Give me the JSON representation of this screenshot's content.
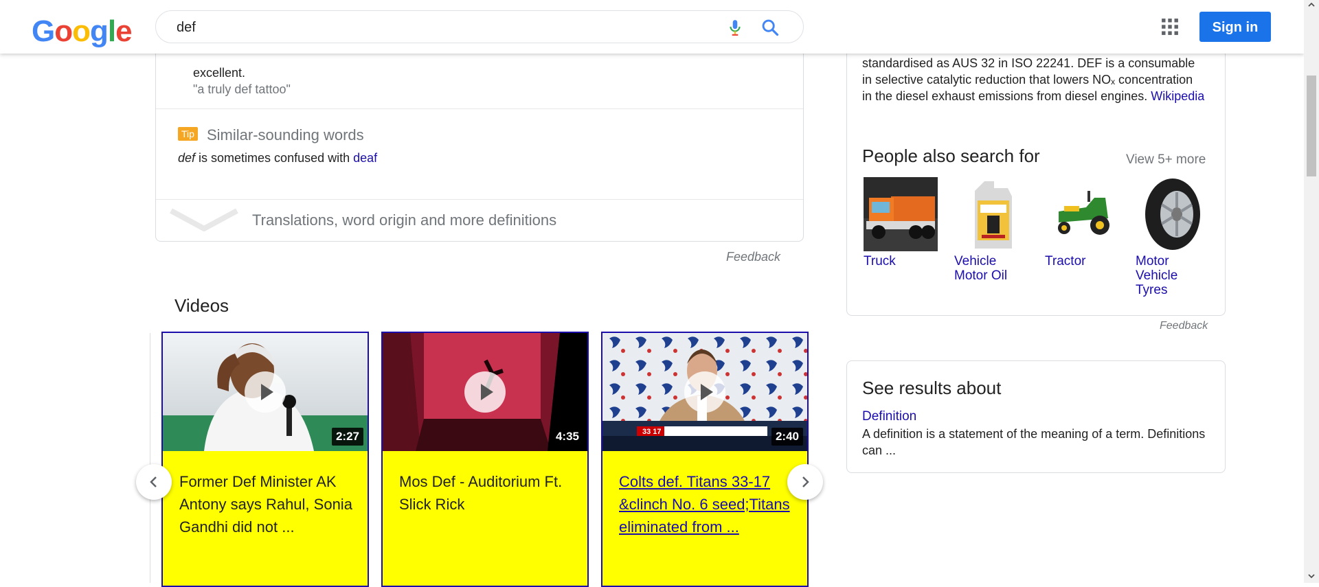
{
  "header": {
    "logo_letters": [
      "G",
      "o",
      "o",
      "g",
      "l",
      "e"
    ],
    "logo_colors": [
      "#4285f4",
      "#ea4335",
      "#fbbc05",
      "#4285f4",
      "#34a853",
      "#ea4335"
    ],
    "search_query": "def",
    "signin_label": "Sign in"
  },
  "dictionary": {
    "definition_tail": "excellent.",
    "example": "\"a truly def tattoo\"",
    "tip_badge": "Tip",
    "similar_heading": "Similar-sounding words",
    "similar_word": "def",
    "similar_middle": " is sometimes confused with ",
    "similar_link": "deaf",
    "more_definitions": "Translations, word origin and more definitions",
    "feedback": "Feedback"
  },
  "videos": {
    "heading": "Videos",
    "items": [
      {
        "title": "Former Def Minister AK Antony says Rahul, Sonia Gandhi did not ...",
        "duration": "2:27"
      },
      {
        "title": "Mos Def - Auditorium Ft. Slick Rick",
        "duration": "4:35"
      },
      {
        "title": "Colts def. Titans 33-17 &clinch No. 6 seed;Titans eliminated from ...",
        "duration": "2:40"
      }
    ],
    "thumbnail_overlay_score": "33 17"
  },
  "knowledge_panel": {
    "description": "standardised as AUS 32 in ISO 22241. DEF is a consumable in selective catalytic reduction that lowers NOₓ concentration in the diesel exhaust emissions from diesel engines.",
    "source_link": "Wikipedia",
    "pas_heading": "People also search for",
    "view_more": "View 5+ more",
    "pas_items": [
      {
        "label": "Truck"
      },
      {
        "label": "Vehicle Motor Oil"
      },
      {
        "label": "Tractor"
      },
      {
        "label": "Motor Vehicle Tyres"
      }
    ],
    "feedback": "Feedback"
  },
  "see_results": {
    "heading": "See results about",
    "link": "Definition",
    "description": "A definition is a statement of the meaning of a term. Definitions can ..."
  },
  "colors": {
    "accent_blue": "#1a73e8",
    "link_blue": "#1a0dab",
    "video_highlight": "#ffff00",
    "tip_orange": "#f5a623"
  }
}
